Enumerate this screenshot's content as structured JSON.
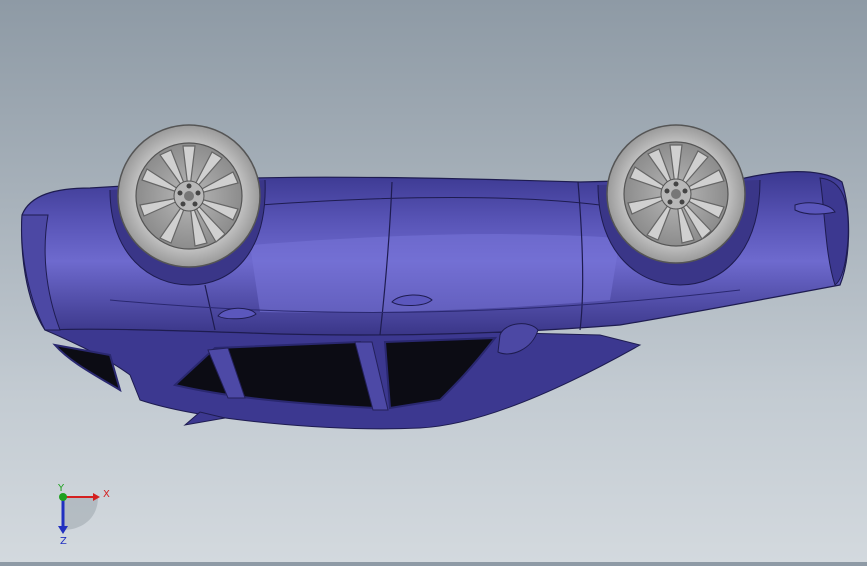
{
  "viewport": {
    "model": "car-upside-down",
    "body_color": "#4e4aa8",
    "window_color": "#0c0c14",
    "background_top": "#8e9aa5",
    "background_bottom": "#d3d9de"
  },
  "triad": {
    "x_label": "X",
    "y_label": "Y",
    "z_label": "Z",
    "x_color": "#d42020",
    "y_color": "#1fa01f",
    "z_color": "#2030c0"
  }
}
